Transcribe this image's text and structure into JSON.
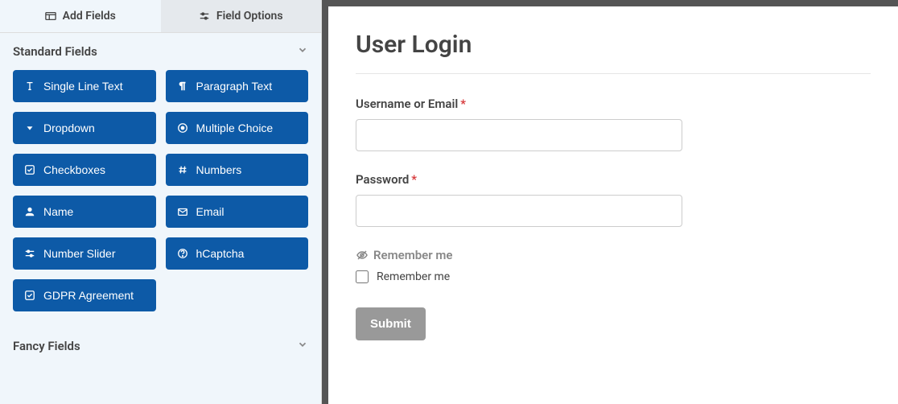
{
  "tabs": {
    "add_fields": "Add Fields",
    "field_options": "Field Options"
  },
  "sections": {
    "standard": "Standard Fields",
    "fancy": "Fancy Fields"
  },
  "standard_fields": [
    {
      "label": "Single Line Text",
      "icon": "text"
    },
    {
      "label": "Paragraph Text",
      "icon": "pilcrow"
    },
    {
      "label": "Dropdown",
      "icon": "caret-down"
    },
    {
      "label": "Multiple Choice",
      "icon": "radio"
    },
    {
      "label": "Checkboxes",
      "icon": "check"
    },
    {
      "label": "Numbers",
      "icon": "hash"
    },
    {
      "label": "Name",
      "icon": "user"
    },
    {
      "label": "Email",
      "icon": "mail"
    },
    {
      "label": "Number Slider",
      "icon": "sliders"
    },
    {
      "label": "hCaptcha",
      "icon": "help"
    },
    {
      "label": "GDPR Agreement",
      "icon": "check"
    }
  ],
  "form": {
    "title": "User Login",
    "username_label": "Username or Email",
    "password_label": "Password",
    "remember_header": "Remember me",
    "remember_label": "Remember me",
    "submit": "Submit"
  }
}
